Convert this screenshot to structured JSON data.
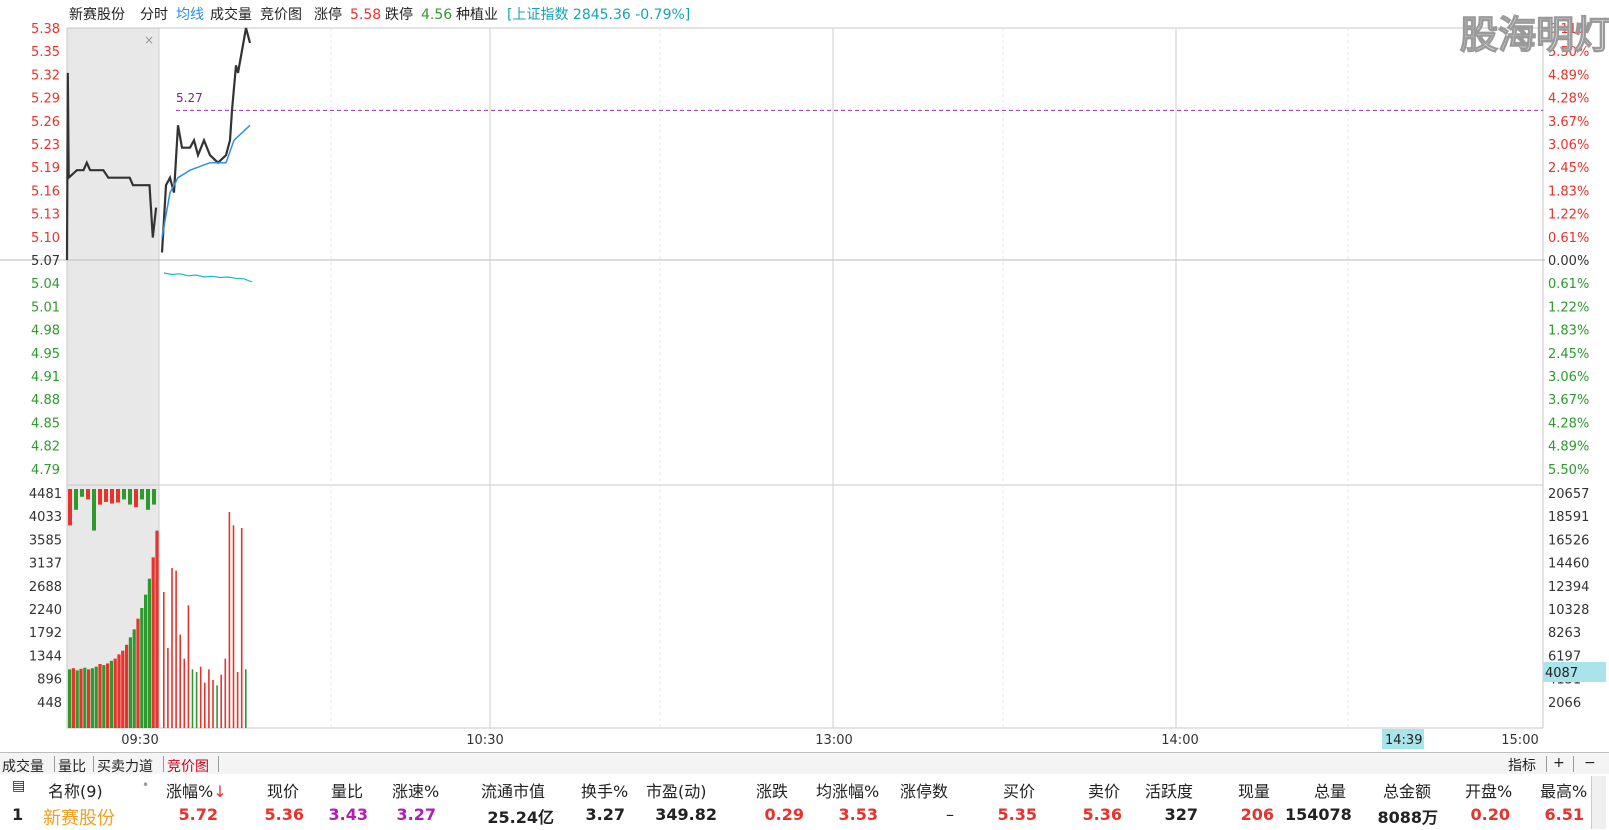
{
  "header": {
    "stock_name": "新赛股份",
    "tab_fenshi": "分时",
    "tab_junxian": "均线",
    "tab_chengjiaoliang": "成交量",
    "tab_jingjia": "竞价图",
    "zhangting_label": "涨停",
    "zhangting_value": "5.58",
    "dieting_label": "跌停",
    "dieting_value": "4.56",
    "industry": "种植业",
    "index_text": "[上证指数 2845.36 -0.79%]"
  },
  "watermark": "股海明灯",
  "colors": {
    "up": "#e8322c",
    "down": "#2e9a2e",
    "avg": "#2f8fe0",
    "price": "#333333",
    "ref": "#9b2fb2",
    "speed": "#17b9c8",
    "auction_bg": "#e8e8e8"
  },
  "chart_data": [
    {
      "type": "line",
      "name": "price-chart",
      "ylim": [
        4.76,
        5.38
      ],
      "ref_price": 5.07,
      "ref_line_value": "5.27",
      "y_ticks_left": [
        "5.38",
        "5.35",
        "5.32",
        "5.29",
        "5.26",
        "5.23",
        "5.19",
        "5.16",
        "5.13",
        "5.10",
        "5.07",
        "5.04",
        "5.01",
        "4.98",
        "4.95",
        "4.91",
        "4.88",
        "4.85",
        "4.82",
        "4.79"
      ],
      "y_ticks_right": [
        "6.11%",
        "5.50%",
        "4.89%",
        "4.28%",
        "3.67%",
        "3.06%",
        "2.45%",
        "1.83%",
        "1.22%",
        "0.61%",
        "0.00%",
        "0.61%",
        "1.22%",
        "1.83%",
        "2.45%",
        "3.06%",
        "3.67%",
        "4.28%",
        "4.89%",
        "5.50%"
      ],
      "x_ticks": [
        "09:30",
        "10:30",
        "13:00",
        "14:00",
        "15:00"
      ],
      "cursor_time": "14:39",
      "auction_price": [
        [
          0,
          5.07
        ],
        [
          0.5,
          5.32
        ],
        [
          1,
          5.18
        ],
        [
          6,
          5.19
        ],
        [
          10,
          5.19
        ],
        [
          12,
          5.2
        ],
        [
          14,
          5.19
        ],
        [
          22,
          5.19
        ],
        [
          25,
          5.18
        ],
        [
          38,
          5.18
        ],
        [
          40,
          5.17
        ],
        [
          50,
          5.17
        ],
        [
          52,
          5.1
        ],
        [
          54,
          5.14
        ]
      ],
      "session_price": [
        [
          0,
          5.08
        ],
        [
          2,
          5.17
        ],
        [
          4,
          5.18
        ],
        [
          6,
          5.16
        ],
        [
          8,
          5.25
        ],
        [
          10,
          5.22
        ],
        [
          14,
          5.22
        ],
        [
          16,
          5.23
        ],
        [
          18,
          5.21
        ],
        [
          21,
          5.23
        ],
        [
          24,
          5.21
        ],
        [
          28,
          5.2
        ],
        [
          32,
          5.21
        ],
        [
          34,
          5.23
        ],
        [
          35,
          5.27
        ],
        [
          37,
          5.33
        ],
        [
          38,
          5.32
        ],
        [
          40,
          5.35
        ],
        [
          42,
          5.38
        ],
        [
          44,
          5.36
        ]
      ],
      "session_avg": [
        [
          0,
          5.1
        ],
        [
          4,
          5.16
        ],
        [
          8,
          5.18
        ],
        [
          14,
          5.19
        ],
        [
          24,
          5.2
        ],
        [
          32,
          5.2
        ],
        [
          36,
          5.23
        ],
        [
          40,
          5.24
        ],
        [
          44,
          5.25
        ]
      ],
      "speed_line": [
        [
          0,
          -0.04
        ],
        [
          4,
          -0.1
        ],
        [
          8,
          -0.07
        ],
        [
          12,
          -0.15
        ],
        [
          16,
          -0.12
        ],
        [
          20,
          -0.2
        ],
        [
          24,
          -0.17
        ],
        [
          28,
          -0.22
        ],
        [
          32,
          -0.2
        ],
        [
          36,
          -0.25
        ],
        [
          40,
          -0.27
        ],
        [
          44,
          -0.4
        ]
      ]
    },
    {
      "type": "bar",
      "name": "volume-chart",
      "ylim": [
        0,
        4481
      ],
      "y_ticks_left": [
        "4481",
        "4033",
        "3585",
        "3137",
        "2688",
        "2240",
        "1792",
        "1344",
        "896",
        "448"
      ],
      "y_ticks_right": [
        "20657",
        "18591",
        "16526",
        "14460",
        "12394",
        "10328",
        "8263",
        "6197",
        "4131",
        "2066"
      ],
      "cursor_value": "4087",
      "auction_bars": [
        {
          "v": 1100,
          "c": "down"
        },
        {
          "v": 1120,
          "c": "up"
        },
        {
          "v": 1080,
          "c": "down"
        },
        {
          "v": 1110,
          "c": "up"
        },
        {
          "v": 1130,
          "c": "down"
        },
        {
          "v": 1100,
          "c": "up"
        },
        {
          "v": 1120,
          "c": "down"
        },
        {
          "v": 1150,
          "c": "down"
        },
        {
          "v": 1200,
          "c": "up"
        },
        {
          "v": 1180,
          "c": "down"
        },
        {
          "v": 1210,
          "c": "up"
        },
        {
          "v": 1260,
          "c": "down"
        },
        {
          "v": 1300,
          "c": "up"
        },
        {
          "v": 1380,
          "c": "up"
        },
        {
          "v": 1450,
          "c": "up"
        },
        {
          "v": 1560,
          "c": "up"
        },
        {
          "v": 1700,
          "c": "down"
        },
        {
          "v": 1850,
          "c": "down"
        },
        {
          "v": 2050,
          "c": "up"
        },
        {
          "v": 2250,
          "c": "down"
        },
        {
          "v": 2500,
          "c": "down"
        },
        {
          "v": 2800,
          "c": "down"
        },
        {
          "v": 3200,
          "c": "up"
        },
        {
          "v": 3700,
          "c": "up"
        }
      ],
      "auction_top_bars": [
        {
          "v": 700,
          "c": "up"
        },
        {
          "v": 400,
          "c": "down"
        },
        {
          "v": 150,
          "c": "down"
        },
        {
          "v": 200,
          "c": "up"
        },
        {
          "v": 800,
          "c": "down"
        },
        {
          "v": 300,
          "c": "up"
        },
        {
          "v": 250,
          "c": "up"
        },
        {
          "v": 280,
          "c": "up"
        },
        {
          "v": 260,
          "c": "up"
        },
        {
          "v": 200,
          "c": "down"
        },
        {
          "v": 300,
          "c": "down"
        },
        {
          "v": 350,
          "c": "up"
        },
        {
          "v": 200,
          "c": "down"
        },
        {
          "v": 400,
          "c": "down"
        },
        {
          "v": 300,
          "c": "down"
        }
      ],
      "session_bars": [
        {
          "v": 2550,
          "c": "up"
        },
        {
          "v": 1500,
          "c": "up"
        },
        {
          "v": 3000,
          "c": "up"
        },
        {
          "v": 2950,
          "c": "up"
        },
        {
          "v": 1750,
          "c": "up"
        },
        {
          "v": 1300,
          "c": "up"
        },
        {
          "v": 2300,
          "c": "up"
        },
        {
          "v": 1100,
          "c": "down"
        },
        {
          "v": 1050,
          "c": "down"
        },
        {
          "v": 1150,
          "c": "up"
        },
        {
          "v": 850,
          "c": "up"
        },
        {
          "v": 1100,
          "c": "up"
        },
        {
          "v": 900,
          "c": "up"
        },
        {
          "v": 800,
          "c": "down"
        },
        {
          "v": 1000,
          "c": "up"
        },
        {
          "v": 1300,
          "c": "up"
        },
        {
          "v": 4050,
          "c": "up"
        },
        {
          "v": 3800,
          "c": "up"
        },
        {
          "v": 1050,
          "c": "up"
        },
        {
          "v": 3750,
          "c": "up"
        },
        {
          "v": 1100,
          "c": "down"
        }
      ]
    }
  ],
  "tabs": [
    "成交量",
    "量比",
    "买卖力道",
    "竞价图"
  ],
  "right_buttons": {
    "zhibiao": "指标",
    "plus": "+",
    "minus": "−"
  },
  "table": {
    "headers": [
      "名称(9)",
      "•",
      "涨幅%",
      "现价",
      "量比",
      "涨速%",
      "流通市值",
      "换手%",
      "市盈(动)",
      "涨跌",
      "均涨幅%",
      "涨停数",
      "买价",
      "卖价",
      "活跃度",
      "现量",
      "总量",
      "总金额",
      "开盘%",
      "最高%"
    ],
    "sort_arrow": "↓",
    "row": [
      "1",
      "新赛股份",
      "5.72",
      "5.36",
      "3.43",
      "3.27",
      "25.24亿",
      "3.27",
      "349.82",
      "0.29",
      "3.53",
      "–",
      "5.35",
      "5.36",
      "327",
      "206",
      "154078",
      "8088万",
      "0.20",
      "6.51"
    ]
  }
}
